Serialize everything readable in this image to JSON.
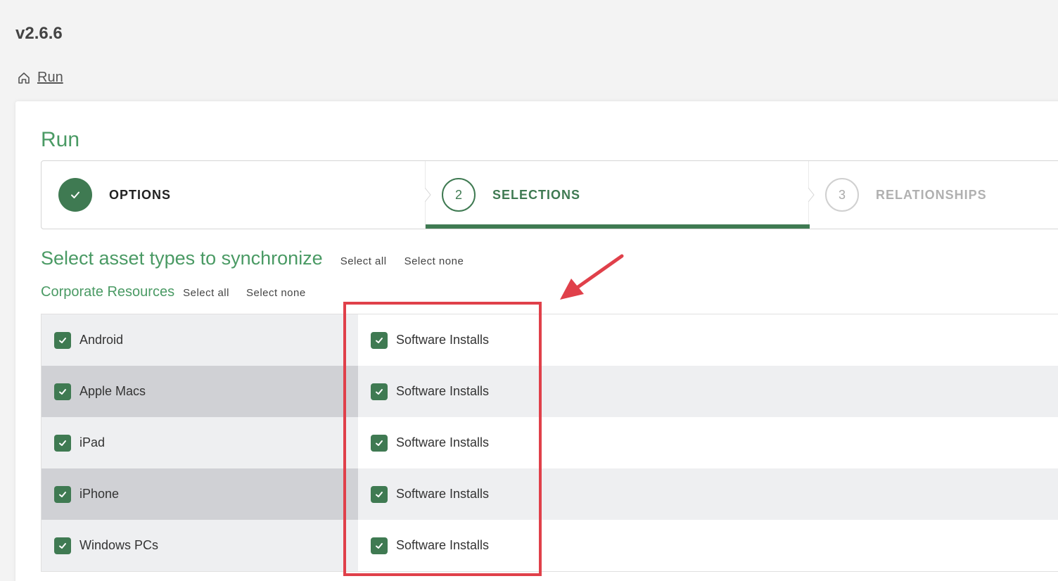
{
  "app": {
    "version": "v2.6.6"
  },
  "breadcrumb": {
    "home_label": "Run"
  },
  "page": {
    "title": "Run"
  },
  "stepper": {
    "steps": [
      {
        "number": "1",
        "label": "OPTIONS",
        "state": "completed"
      },
      {
        "number": "2",
        "label": "SELECTIONS",
        "state": "active"
      },
      {
        "number": "3",
        "label": "RELATIONSHIPS",
        "state": "pending"
      }
    ]
  },
  "section": {
    "title": "Select asset types to synchronize",
    "select_all": "Select all",
    "select_none": "Select none"
  },
  "group": {
    "title": "Corporate Resources",
    "select_all": "Select all",
    "select_none": "Select none",
    "rows": [
      {
        "asset": "Android",
        "asset_checked": true,
        "child": "Software Installs",
        "child_checked": true
      },
      {
        "asset": "Apple Macs",
        "asset_checked": true,
        "child": "Software Installs",
        "child_checked": true
      },
      {
        "asset": "iPad",
        "asset_checked": true,
        "child": "Software Installs",
        "child_checked": true
      },
      {
        "asset": "iPhone",
        "asset_checked": true,
        "child": "Software Installs",
        "child_checked": true
      },
      {
        "asset": "Windows PCs",
        "asset_checked": true,
        "child": "Software Installs",
        "child_checked": true
      }
    ]
  },
  "colors": {
    "brand_green": "#3f7a52",
    "title_green": "#4a9a64",
    "annotation_red": "#e0404a"
  }
}
